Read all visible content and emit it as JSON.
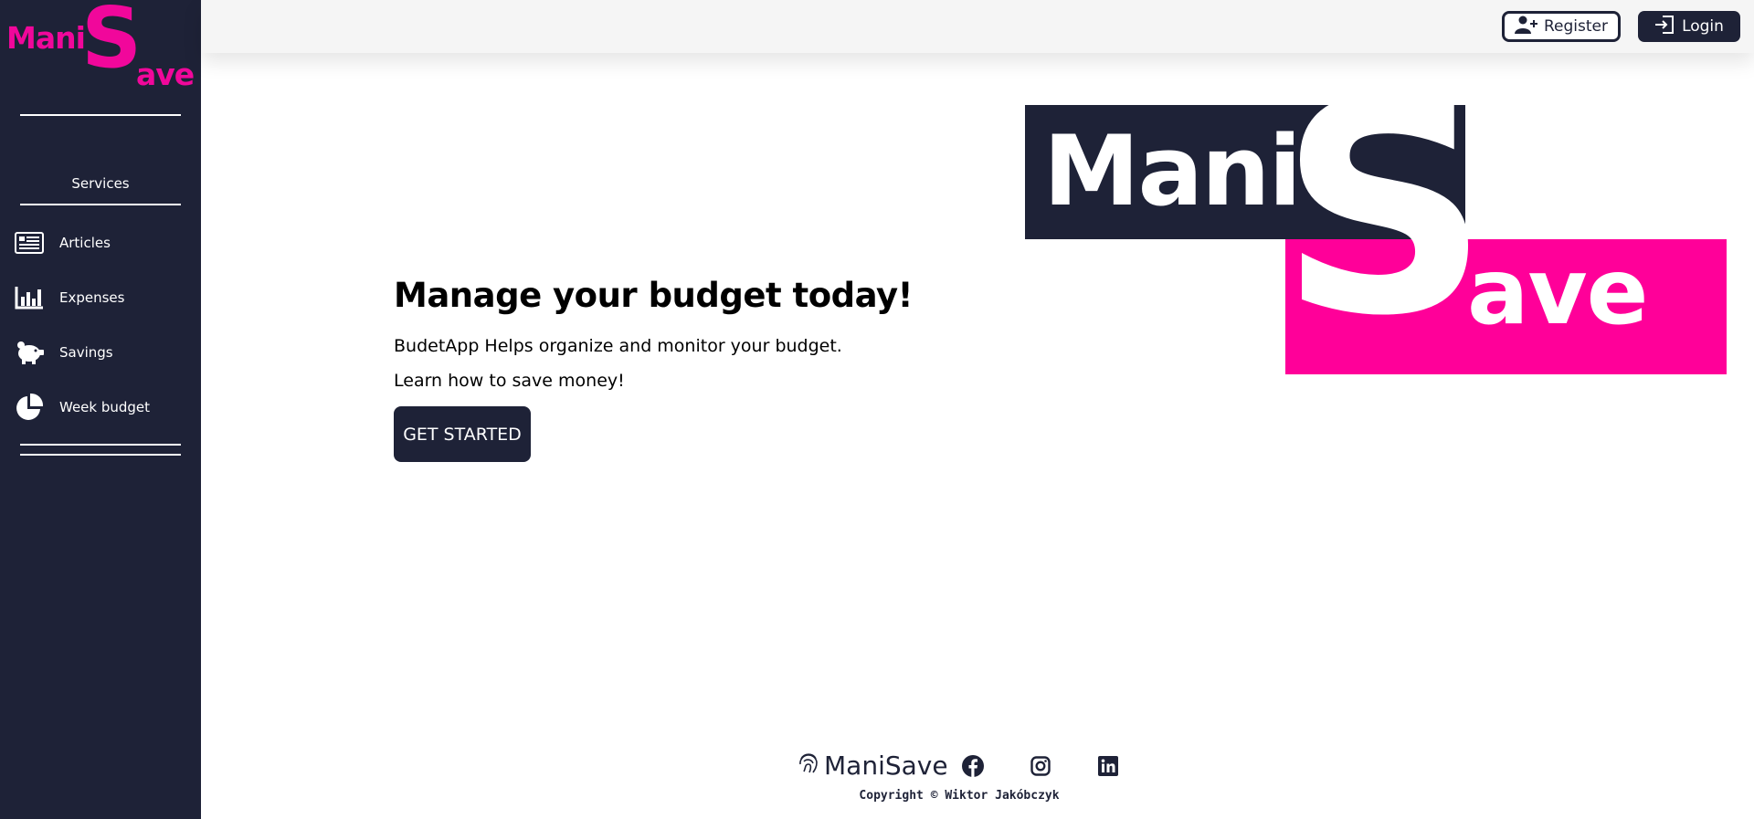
{
  "sidebar": {
    "brand": {
      "part1": "Mani",
      "big_letter": "S",
      "part2": "ave"
    },
    "services_label": "Services",
    "items": [
      {
        "label": "Articles",
        "icon": "newspaper-icon"
      },
      {
        "label": "Expenses",
        "icon": "bar-chart-icon"
      },
      {
        "label": "Savings",
        "icon": "piggy-bank-icon"
      },
      {
        "label": "Week budget",
        "icon": "pie-chart-icon"
      }
    ]
  },
  "header": {
    "register_label": "Register",
    "login_label": "Login"
  },
  "hero": {
    "title": "Manage your budget today!",
    "line1": "BudetApp Helps organize and monitor your budget.",
    "line2": "Learn how to save money!",
    "cta_label": "GET STARTED"
  },
  "logo": {
    "part1": "Mani",
    "big_letter": "S",
    "part2": "ave"
  },
  "footer": {
    "brand": "ManiSave",
    "copyright": "Copyright © Wiktor Jakóbczyk",
    "social": [
      "facebook-icon",
      "instagram-icon",
      "linkedin-icon"
    ]
  },
  "colors": {
    "navy": "#1e2237",
    "pink": "#ff0099",
    "brand_pink": "#f1079b"
  }
}
